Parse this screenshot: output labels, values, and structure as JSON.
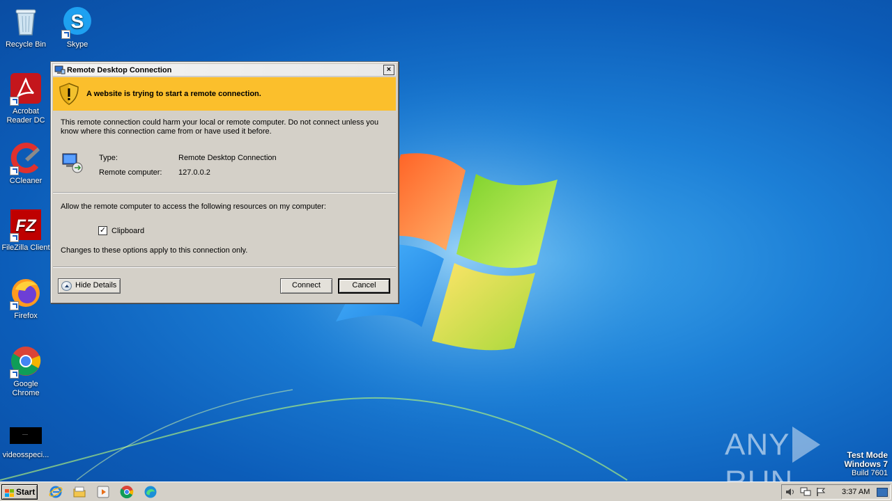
{
  "desktop": {
    "icons": [
      {
        "label": "Recycle Bin",
        "icon": "recycle-bin-icon"
      },
      {
        "label": "Skype",
        "icon": "skype-icon"
      },
      {
        "label": "Acrobat Reader DC",
        "icon": "acrobat-icon"
      },
      {
        "label": "CCleaner",
        "icon": "ccleaner-icon"
      },
      {
        "label": "FileZilla Client",
        "icon": "filezilla-icon"
      },
      {
        "label": "Firefox",
        "icon": "firefox-icon"
      },
      {
        "label": "Google Chrome",
        "icon": "chrome-icon"
      },
      {
        "label": "videosspeci...",
        "icon": "video-file-icon"
      }
    ],
    "watermark": {
      "left": "ANY",
      "right": "RUN"
    },
    "test_mode": {
      "line1": "Test Mode",
      "line2": "Windows 7",
      "line3": "Build 7601"
    }
  },
  "dialog": {
    "title": "Remote Desktop Connection",
    "close_glyph": "×",
    "banner_text": "A website is trying to start a remote connection.",
    "warning_text": "This remote connection could harm your local or remote computer. Do not connect unless you know where this connection came from or have used it before.",
    "info": {
      "type_label": "Type:",
      "type_value": "Remote Desktop Connection",
      "computer_label": "Remote computer:",
      "computer_value": "127.0.0.2"
    },
    "allow_text": "Allow the remote computer to access the following resources on my computer:",
    "clipboard": {
      "label": "Clipboard",
      "checked_glyph": "✓"
    },
    "changes_text": "Changes to these options apply to this connection only.",
    "buttons": {
      "hide_details": "Hide Details",
      "connect": "Connect",
      "cancel": "Cancel"
    }
  },
  "taskbar": {
    "start_label": "Start",
    "clock": "3:37 AM"
  },
  "colors": {
    "banner": "#fbbf2c",
    "dialog_bg": "#d4d0c8",
    "desktop_blue": "#1c7fd6"
  }
}
